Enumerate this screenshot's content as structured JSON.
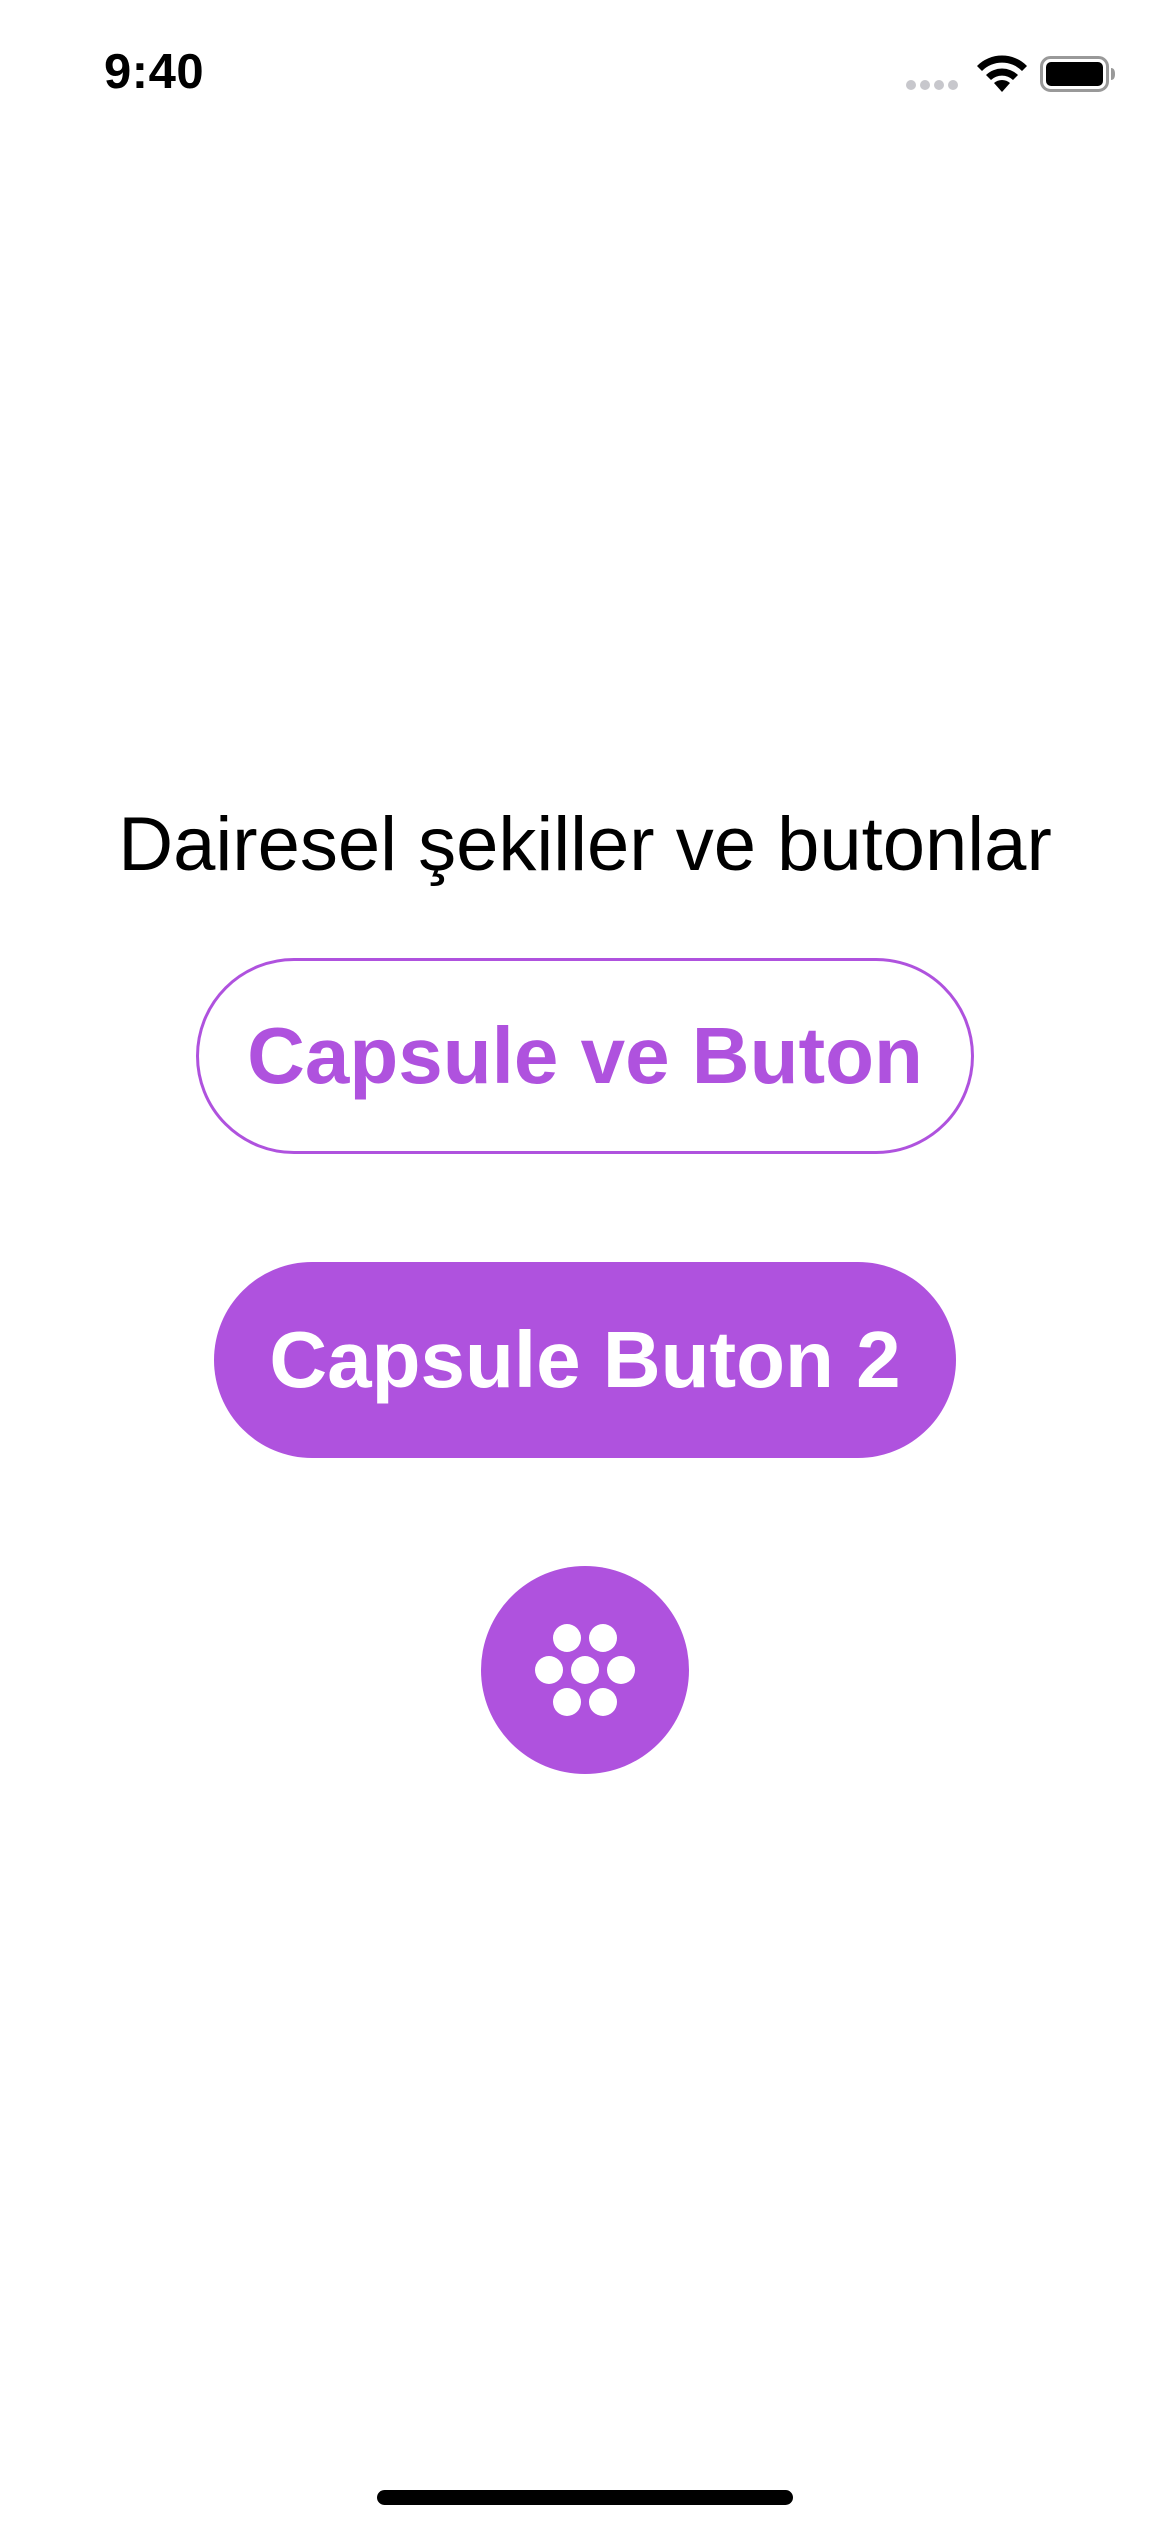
{
  "status_bar": {
    "time": "9:40"
  },
  "main": {
    "title": "Dairesel şekiller ve butonlar",
    "capsule_outline_label": "Capsule ve Buton",
    "capsule_filled_label": "Capsule Buton 2",
    "circle_button_icon": "circle-grid-hex-icon"
  },
  "colors": {
    "accent": "#af52de",
    "text": "#000000",
    "background": "#ffffff"
  }
}
